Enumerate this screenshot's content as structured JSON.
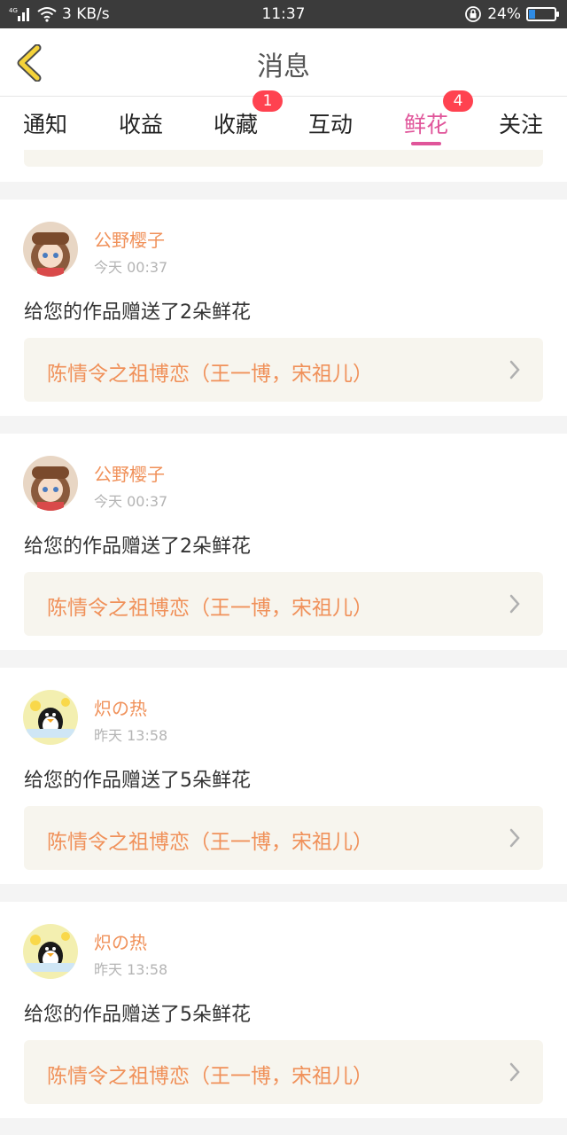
{
  "status_bar": {
    "network": "4G",
    "speed": "3 KB/s",
    "time": "11:37",
    "battery": "24%",
    "battery_level": 0.24
  },
  "header": {
    "title": "消息"
  },
  "tabs": [
    {
      "label": "通知",
      "badge": null
    },
    {
      "label": "收益",
      "badge": null
    },
    {
      "label": "收藏",
      "badge": "1"
    },
    {
      "label": "互动",
      "badge": null
    },
    {
      "label": "鲜花",
      "badge": "4",
      "active": true
    },
    {
      "label": "关注",
      "badge": null
    }
  ],
  "messages": [
    {
      "user": "公野樱子",
      "time": "今天 00:37",
      "text": "给您的作品赠送了2朵鲜花",
      "work": "陈情令之祖博恋（王一博，宋祖儿）"
    },
    {
      "user": "公野樱子",
      "time": "今天 00:37",
      "text": "给您的作品赠送了2朵鲜花",
      "work": "陈情令之祖博恋（王一博，宋祖儿）"
    },
    {
      "user": "炽の热",
      "time": "昨天 13:58",
      "text": "给您的作品赠送了5朵鲜花",
      "work": "陈情令之祖博恋（王一博，宋祖儿）"
    },
    {
      "user": "炽の热",
      "time": "昨天 13:58",
      "text": "给您的作品赠送了5朵鲜花",
      "work": "陈情令之祖博恋（王一博，宋祖儿）"
    }
  ],
  "colors": {
    "accent_pink": "#e0559a",
    "accent_orange": "#f0915a",
    "badge_red": "#ff4250",
    "back_arrow_yellow": "#f5d33a"
  }
}
